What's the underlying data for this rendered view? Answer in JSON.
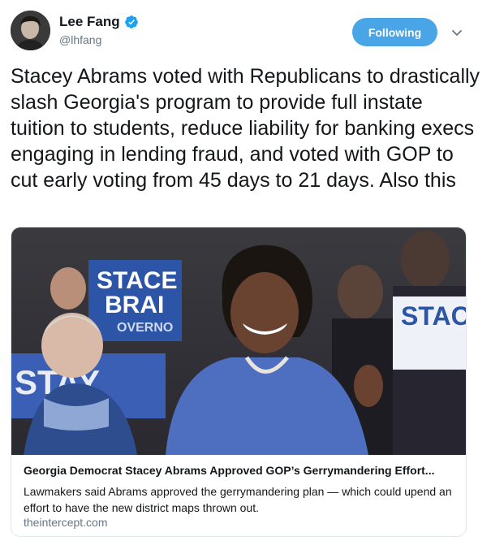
{
  "author": {
    "name": "Lee Fang",
    "handle": "@lhfang",
    "verified_icon": "verified-badge-icon",
    "follow_label": "Following",
    "menu_icon": "chevron-down-icon"
  },
  "tweet": {
    "text": "Stacey Abrams voted with Republicans to drastically slash Georgia's program to provide full instate tuition to students, reduce liability for banking execs engaging in lending fraud, and voted with GOP to cut early voting from 45 days to 21 days. Also this"
  },
  "card": {
    "image_sign_text": [
      "STACE",
      "BRAI",
      "OVERNO",
      "STAY",
      "STAC"
    ],
    "title": "Georgia Democrat Stacey Abrams Approved GOP’s Gerrymandering Effort...",
    "description": "Lawmakers said Abrams approved the gerrymandering plan — which could upend an effort to have the new district maps thrown out.",
    "domain": "theintercept.com"
  },
  "colors": {
    "accent": "#4aa5e6",
    "text": "#14171a",
    "muted": "#657786",
    "border": "#e1e8ed"
  }
}
